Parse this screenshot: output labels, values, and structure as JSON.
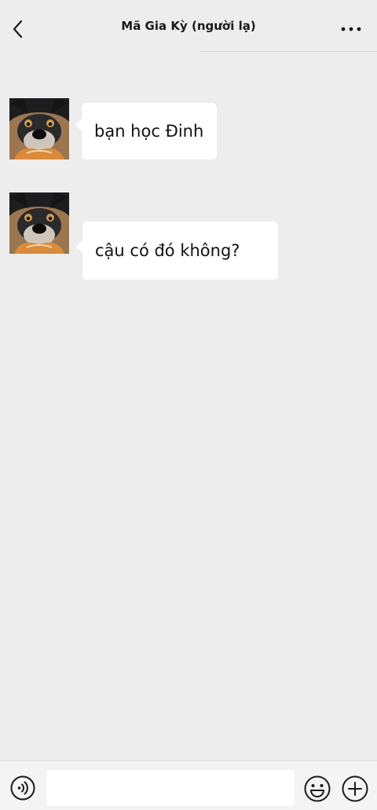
{
  "header": {
    "title": "Mã Gia Kỳ (người lạ)",
    "back_icon": "chevron-left-icon",
    "more_icon": "more-horizontal-icon"
  },
  "messages": [
    {
      "sender": "other",
      "avatar": "dog-avatar",
      "text": "bạn học Đinh"
    },
    {
      "sender": "other",
      "avatar": "dog-avatar",
      "text": "cậu có đó không?"
    }
  ],
  "input_bar": {
    "voice_icon": "voice-icon",
    "input_value": "",
    "emoji_icon": "emoji-icon",
    "plus_icon": "plus-circle-icon"
  },
  "colors": {
    "background": "#ededed",
    "bubble": "#ffffff",
    "input_bar": "#f4f4f4",
    "text": "#111111"
  }
}
